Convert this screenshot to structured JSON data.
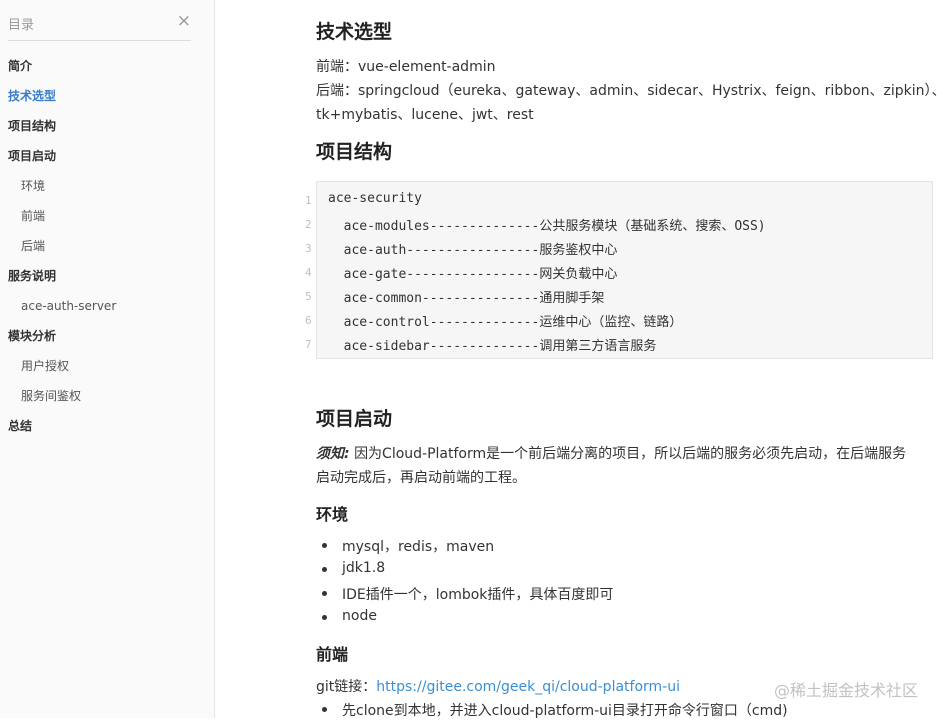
{
  "toc": {
    "title": "目录",
    "close_icon": "×",
    "items": [
      {
        "label": "简介"
      },
      {
        "label": "技术选型"
      },
      {
        "label": "项目结构"
      },
      {
        "label": "项目启动"
      },
      {
        "label": "环境"
      },
      {
        "label": "前端"
      },
      {
        "label": "后端"
      },
      {
        "label": "服务说明"
      },
      {
        "label": "ace-auth-server"
      },
      {
        "label": "模块分析"
      },
      {
        "label": "用户授权"
      },
      {
        "label": "服务间鉴权"
      },
      {
        "label": "总结"
      }
    ]
  },
  "content": {
    "tech_heading": "技术选型",
    "frontend_line": "前端：vue-element-admin",
    "backend_line1": "后端：springcloud（eureka、gateway、admin、sidecar、Hystrix、feign、ribbon、zipkin）、",
    "backend_line2": "tk+mybatis、lucene、jwt、rest",
    "struct_heading": "项目结构",
    "code_lines": [
      {
        "n": "1",
        "text": "ace-security"
      },
      {
        "n": "2",
        "text": "  ace-modules--------------公共服务模块（基础系统、搜索、OSS)"
      },
      {
        "n": "3",
        "text": "  ace-auth-----------------服务鉴权中心"
      },
      {
        "n": "4",
        "text": "  ace-gate-----------------网关负载中心"
      },
      {
        "n": "5",
        "text": "  ace-common---------------通用脚手架"
      },
      {
        "n": "6",
        "text": "  ace-control--------------运维中心（监控、链路）"
      },
      {
        "n": "7",
        "text": "  ace-sidebar--------------调用第三方语言服务"
      }
    ],
    "startup_heading": "项目启动",
    "notice_label": "须知:",
    "notice_line1": "因为Cloud-Platform是一个前后端分离的项目，所以后端的服务必须先启动，在后端服务",
    "notice_line2": "启动完成后，再启动前端的工程。",
    "env_heading": "环境",
    "env_items": [
      "mysql，redis，maven",
      "jdk1.8",
      "IDE插件一个，lombok插件，具体百度即可",
      "node"
    ],
    "frontend_heading": "前端",
    "git_label": "git链接：",
    "git_url": "https://gitee.com/geek_qi/cloud-platform-ui",
    "clone_item": "先clone到本地，并进入cloud-platform-ui目录打开命令行窗口（cmd)"
  },
  "watermark": "@稀土掘金技术社区",
  "colors": {
    "accent": "#3a7dc7",
    "link": "#3a8fd1",
    "code_bg": "#f6f6f6",
    "sidebar_bg": "#fafafa"
  }
}
